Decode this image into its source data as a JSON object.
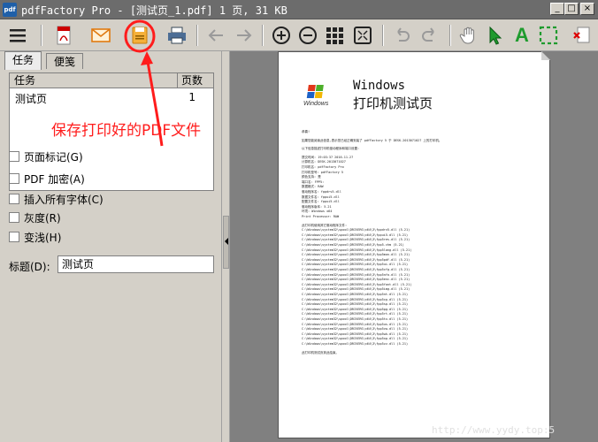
{
  "window": {
    "app_icon_text": "pdf",
    "title": "pdfFactory Pro - [测试页_1.pdf] 1 页, 31 KB",
    "min": "_",
    "max": "□",
    "close": "×"
  },
  "toolbar": {
    "icons": [
      "menu-icon",
      "pdf-icon",
      "email-icon",
      "save-icon",
      "print-icon",
      "back-arrow-icon",
      "forward-arrow-icon",
      "zoom-in-icon",
      "zoom-out-icon",
      "grid-icon",
      "fullscreen-icon",
      "undo-icon",
      "redo-icon",
      "hand-icon",
      "pointer-icon",
      "text-tool-icon",
      "select-tool-icon",
      "delete-page-icon"
    ],
    "text_tool_label": "A"
  },
  "tabs": [
    {
      "label": "任务"
    },
    {
      "label": "便笺"
    }
  ],
  "task_list": {
    "columns": [
      "任务",
      "页数"
    ],
    "rows": [
      {
        "name": "测试页",
        "pages": "1"
      }
    ]
  },
  "annotation": "保存打印好的PDF文件",
  "options": [
    {
      "label": "页面标记(G)"
    },
    {
      "label": "PDF 加密(A)"
    },
    {
      "label": "插入所有字体(C)"
    },
    {
      "label": "灰度(R)"
    },
    {
      "label": "变浅(H)"
    }
  ],
  "title_field": {
    "label": "标题(D):",
    "value": "测试页"
  },
  "document": {
    "logo_text": "Windows",
    "heading_en": "Windows",
    "heading_cn": "打印机测试页",
    "body_lines": [
      "恭喜!",
      "如果您能阅读此信息,表示您已经正确安装了 pdfFactory 5 于 DESK-2013071027 上的打印机。",
      "以下信息描述打印机驱动程序和端口设置:",
      "提交时间: 19:03:37 2016-11-27",
      "计算机名: DESK-2013071027",
      "打印机名: pdfFactory Pro",
      "打印机型号: pdfFactory 5",
      "颜色支持: 是",
      "端口名: FPP5:",
      "数据格式: RAW",
      "驱动程序名: fppdrv5.dll",
      "数据文件名: fppui5.dll",
      "配置文件名: fppui5.dll",
      "驱动程序版本: 5.21",
      "环境: Windows x64",
      "Print Processor: RAW",
      "此打印机使用其它驱动程序文件:",
      "C:\\Windows\\system32\\spool\\DRIVERS\\x64\\3\\fppdrv5.dll (5.21)",
      "C:\\Windows\\system32\\spool\\DRIVERS\\x64\\3\\fppui5.dll (5.21)",
      "C:\\Windows\\system32\\spool\\DRIVERS\\x64\\3\\fpp5res.dll (5.21)",
      "C:\\Windows\\system32\\spool\\DRIVERS\\x64\\3\\fpp5.chm (5.21)",
      "C:\\Windows\\system32\\spool\\DRIVERS\\x64\\3\\fpp5lang.dll (5.21)",
      "C:\\Windows\\system32\\spool\\DRIVERS\\x64\\3\\fpp5mon.dll (5.21)",
      "C:\\Windows\\system32\\spool\\DRIVERS\\x64\\3\\fpp5pdf.dll (5.21)",
      "C:\\Windows\\system32\\spool\\DRIVERS\\x64\\3\\fpp5ui.dll (5.21)",
      "C:\\Windows\\system32\\spool\\DRIVERS\\x64\\3\\fpp5cfg.dll (5.21)",
      "C:\\Windows\\system32\\spool\\DRIVERS\\x64\\3\\fpp5nfo.dll (5.21)",
      "C:\\Windows\\system32\\spool\\DRIVERS\\x64\\3\\fpp5enc.dll (5.21)",
      "C:\\Windows\\system32\\spool\\DRIVERS\\x64\\3\\fpp5font.dll (5.21)",
      "C:\\Windows\\system32\\spool\\DRIVERS\\x64\\3\\fpp5img.dll (5.21)",
      "C:\\Windows\\system32\\spool\\DRIVERS\\x64\\3\\fpp5nt.dll (5.21)",
      "C:\\Windows\\system32\\spool\\DRIVERS\\x64\\3\\fpp5cp.dll (5.21)",
      "C:\\Windows\\system32\\spool\\DRIVERS\\x64\\3\\fpp5sp.dll (5.21)",
      "C:\\Windows\\system32\\spool\\DRIVERS\\x64\\3\\fpp5pg.dll (5.21)",
      "C:\\Windows\\system32\\spool\\DRIVERS\\x64\\3\\fpp5rt.dll (5.21)",
      "C:\\Windows\\system32\\spool\\DRIVERS\\x64\\3\\fpp5tx.dll (5.21)",
      "C:\\Windows\\system32\\spool\\DRIVERS\\x64\\3\\fpp5us.dll (5.21)",
      "C:\\Windows\\system32\\spool\\DRIVERS\\x64\\3\\fpp5vw.dll (5.21)",
      "C:\\Windows\\system32\\spool\\DRIVERS\\x64\\3\\fpp5wk.dll (5.21)",
      "C:\\Windows\\system32\\spool\\DRIVERS\\x64\\3\\fpp5xp.dll (5.21)",
      "C:\\Windows\\system32\\spool\\DRIVERS\\x64\\3\\fpp5zz.dll (5.21)",
      "此打印机测试页到此结束。"
    ]
  },
  "watermark": "http://www.yydy.top:5"
}
